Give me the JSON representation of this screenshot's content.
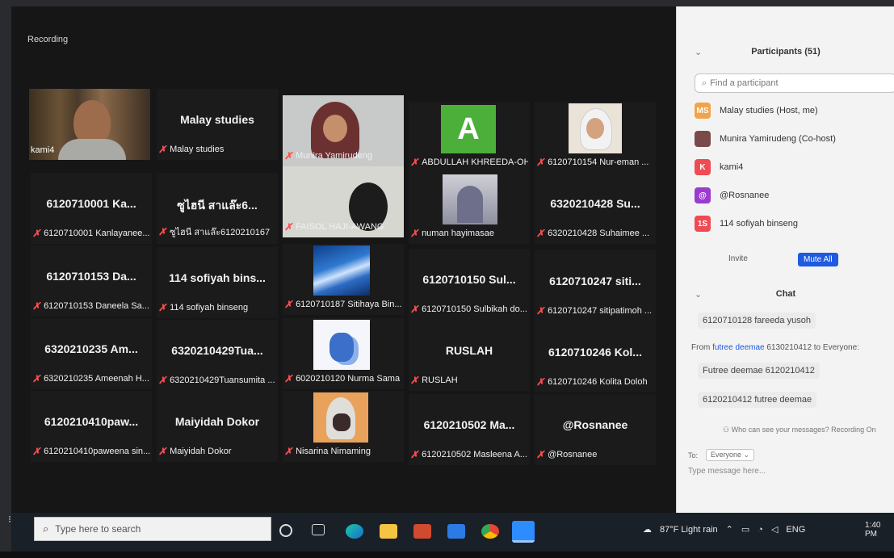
{
  "meeting": {
    "recording_label": "Recording",
    "tiles": [
      {
        "label": "",
        "name": "kami4"
      },
      {
        "label": "Malay studies",
        "name": "Malay studies"
      },
      {
        "label": "",
        "name": "Munira Yamirudeng"
      },
      {
        "label": "",
        "name": "ABDULLAH KHREEDA-OH",
        "avatar_letter": "A"
      },
      {
        "label": "",
        "name": "6120710154 Nur-eman ..."
      },
      {
        "label": "6120710001 Ka...",
        "name": "6120710001 Kanlayanee..."
      },
      {
        "label": "ซูไฮนี สาแล๊ะ6...",
        "name": "ซูไฮนี สาแล๊ะ6120210167"
      },
      {
        "label": "",
        "name": "FAISOL HAJI-AWANG"
      },
      {
        "label": "",
        "name": "numan hayimasae"
      },
      {
        "label": "6320210428 Su...",
        "name": "6320210428 Suhaimee ..."
      },
      {
        "label": "6120710153 Da...",
        "name": "6120710153 Daneela Sa..."
      },
      {
        "label": "114 sofiyah bins...",
        "name": "114 sofiyah binseng"
      },
      {
        "label": "",
        "name": "6120710187 Sitihaya Bin..."
      },
      {
        "label": "6120710150 Sul...",
        "name": "6120710150 Sulbikah do..."
      },
      {
        "label": "6120710247 siti...",
        "name": "6120710247 sitipatimoh ..."
      },
      {
        "label": "6320210235 Am...",
        "name": "6320210235 Ameenah H..."
      },
      {
        "label": "6320210429Tua...",
        "name": "6320210429Tuansumita ..."
      },
      {
        "label": "",
        "name": "6020210120 Nurma Sama"
      },
      {
        "label": "RUSLAH",
        "name": "RUSLAH"
      },
      {
        "label": "6120710246 Kol...",
        "name": "6120710246 Kolita  Doloh"
      },
      {
        "label": "6120210410paw...",
        "name": "6120210410paweena sin..."
      },
      {
        "label": "Maiyidah Dokor",
        "name": "Maiyidah Dokor"
      },
      {
        "label": "",
        "name": "Nisarina Nimaming"
      },
      {
        "label": "6120210502 Ma...",
        "name": "6120210502 Masleena A..."
      },
      {
        "label": "@Rosnanee",
        "name": "@Rosnanee"
      }
    ]
  },
  "participants": {
    "title": "Participants (51)",
    "search_placeholder": "Find a participant",
    "list": [
      {
        "initials": "MS",
        "name": "Malay studies (Host, me)",
        "color": "#f0a44b"
      },
      {
        "initials": "",
        "name": "Munira Yamirudeng (Co-host)",
        "color": "#7a4a4a"
      },
      {
        "initials": "K",
        "name": "kami4",
        "color": "#ef4b54"
      },
      {
        "initials": "@",
        "name": "@Rosnanee",
        "color": "#9b3bd0"
      },
      {
        "initials": "1S",
        "name": "114 sofiyah binseng",
        "color": "#ef4b54"
      }
    ],
    "invite_label": "Invite",
    "mute_all_label": "Mute All"
  },
  "chat": {
    "title": "Chat",
    "msg1": "6120710128 fareeda yusoh",
    "from_prefix": "From ",
    "from_sender": "futree deemae",
    "from_suffix": " 6130210412 to Everyone:",
    "msg2": "Futree deemae 6120210412",
    "msg3": "6120210412 futree deemae",
    "who_can_see": "Who can see your messages? Recording On",
    "to_label": "To:",
    "to_value": "Everyone",
    "input_placeholder": "Type message here..."
  },
  "taskbar": {
    "search_placeholder": "Type here to search",
    "weather": "87°F  Light rain",
    "lang": "ENG",
    "time": "1:40 PM"
  }
}
